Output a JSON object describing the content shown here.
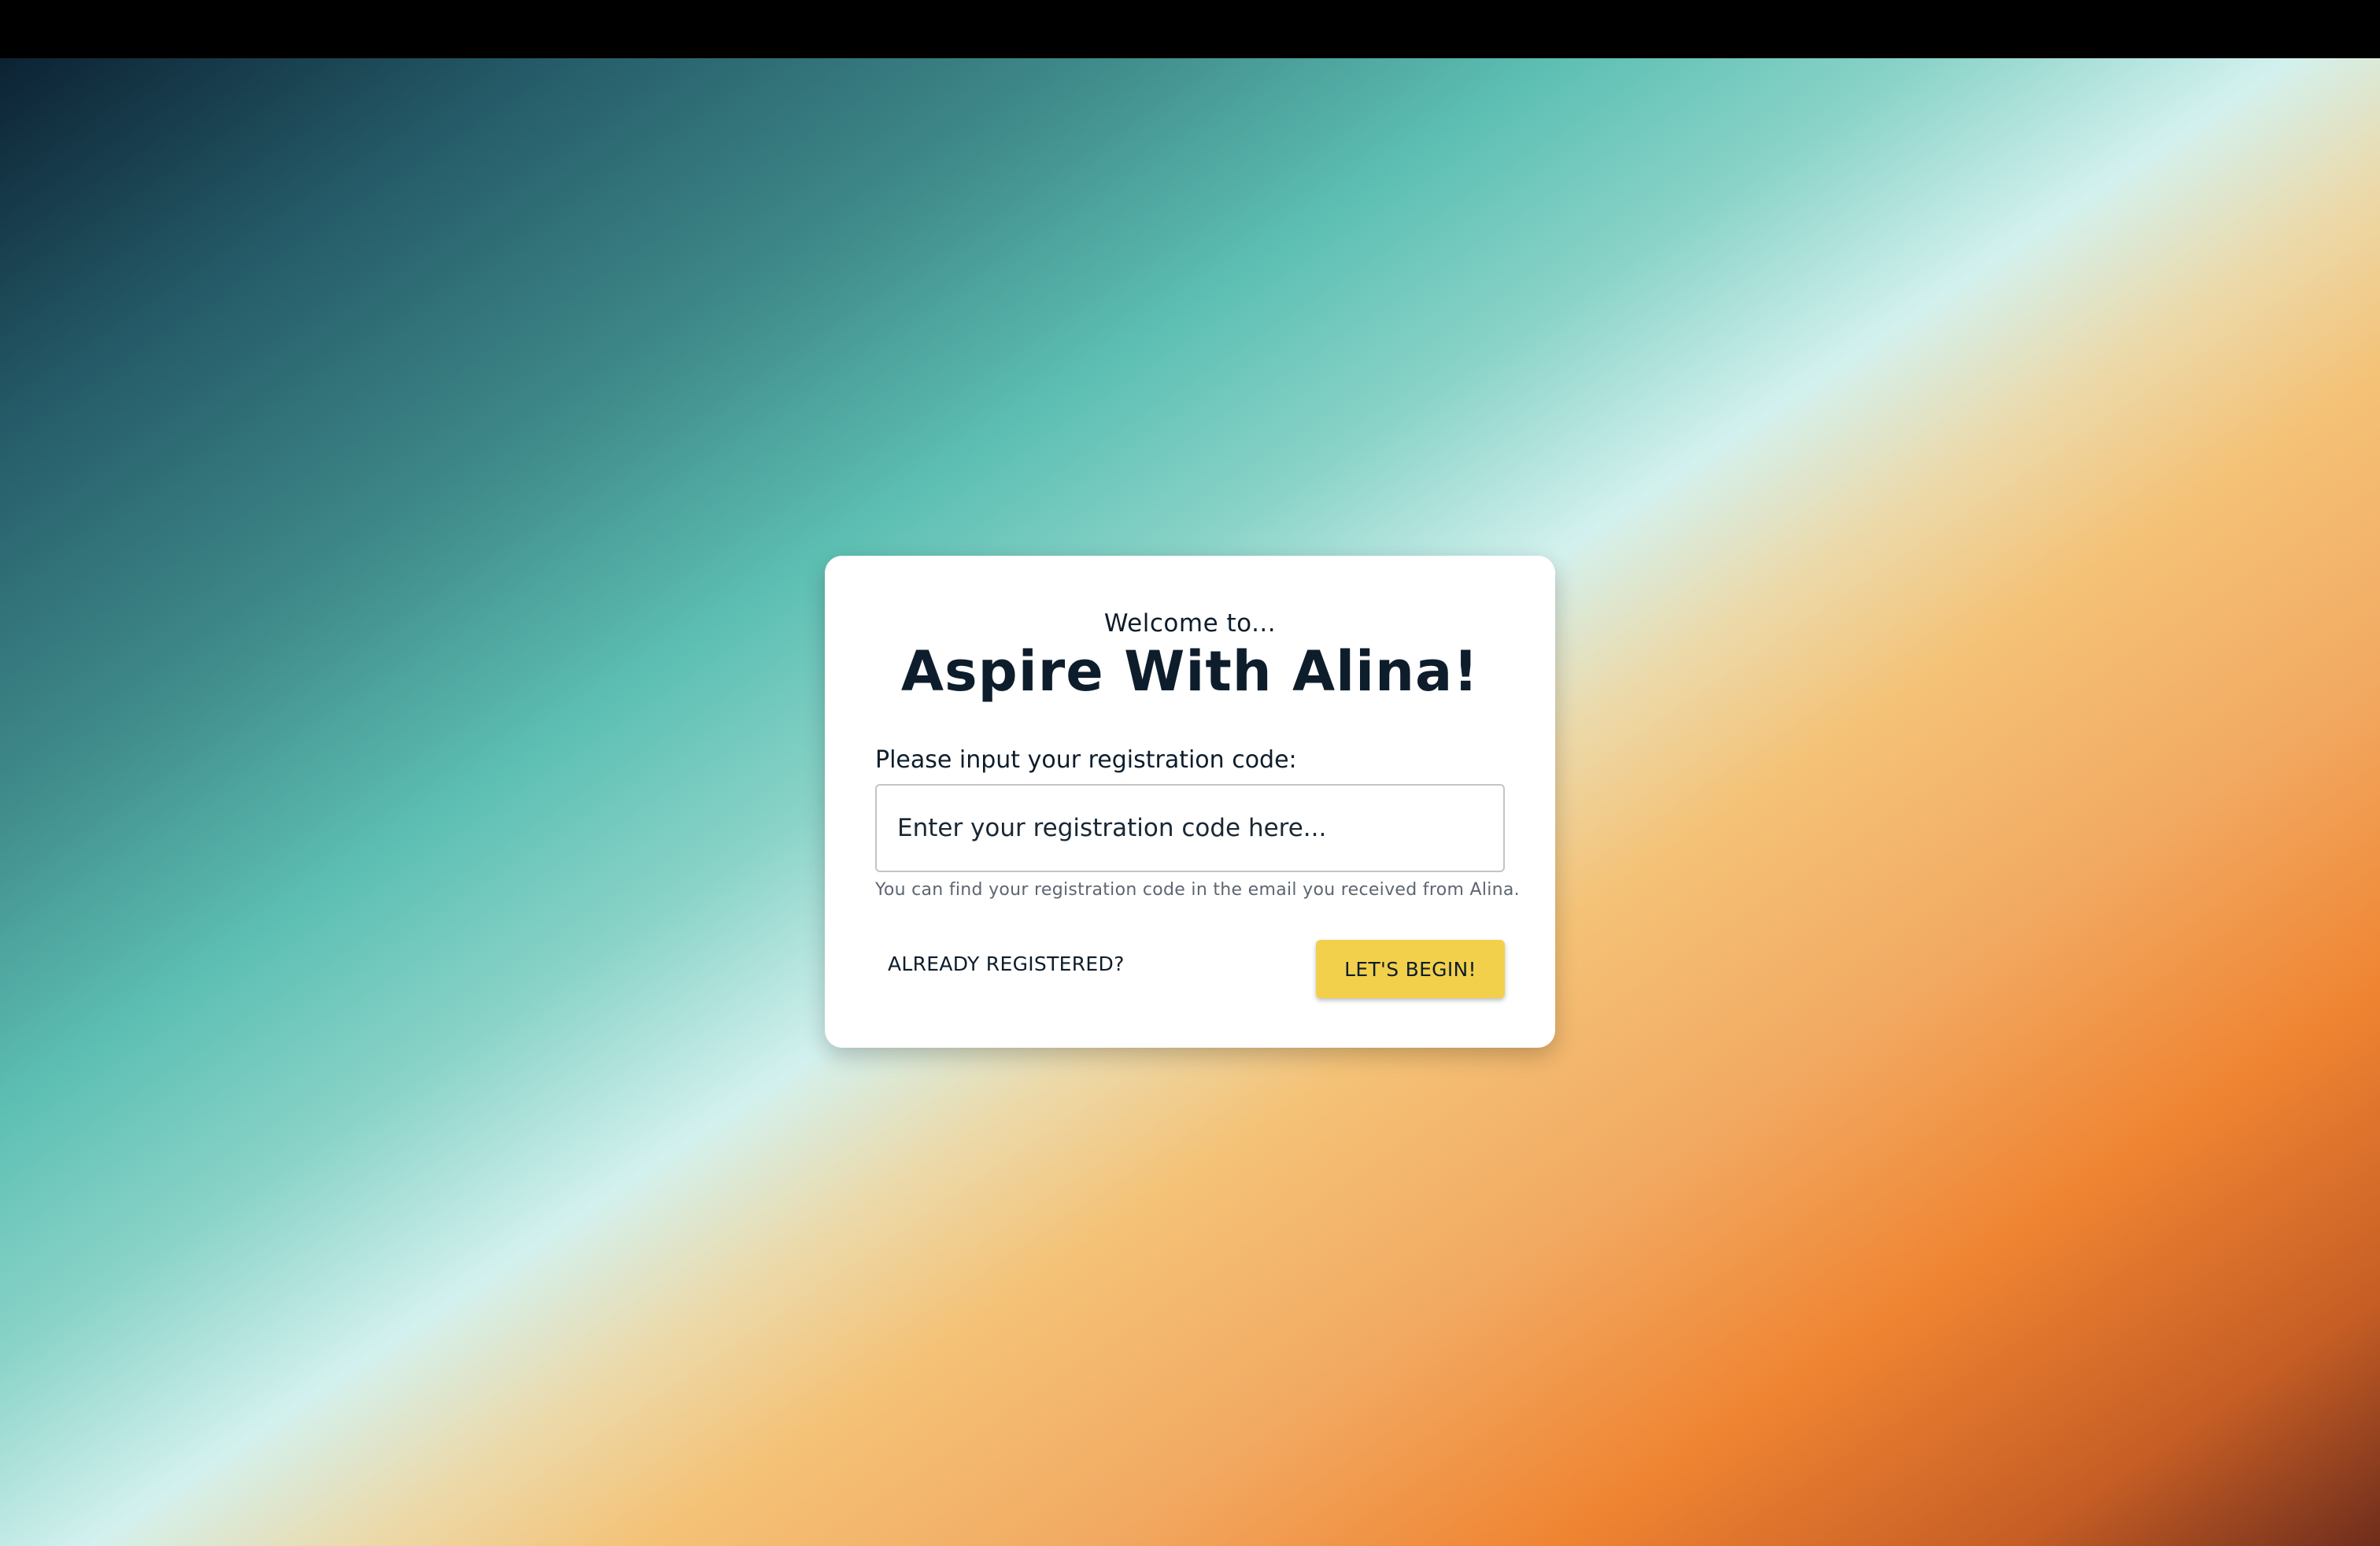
{
  "welcome_text": "Welcome to...",
  "app_title": "Aspire With Alina!",
  "form": {
    "label": "Please input your registration code:",
    "input_value": "",
    "input_placeholder": "Enter your registration code here...",
    "hint": "You can find your registration code in the email you received from Alina."
  },
  "actions": {
    "already_registered_label": "ALREADY REGISTERED?",
    "begin_label": "LET'S BEGIN!"
  },
  "colors": {
    "accent_button": "#f2d04b",
    "text_dark": "#0d1d2b",
    "card_background": "#ffffff",
    "gradient_dark_teal": "#0c2233",
    "gradient_teal": "#5dbfb3",
    "gradient_light": "#d3f1ee",
    "gradient_orange": "#ef8432",
    "gradient_dark_orange": "#6e2d1c"
  }
}
